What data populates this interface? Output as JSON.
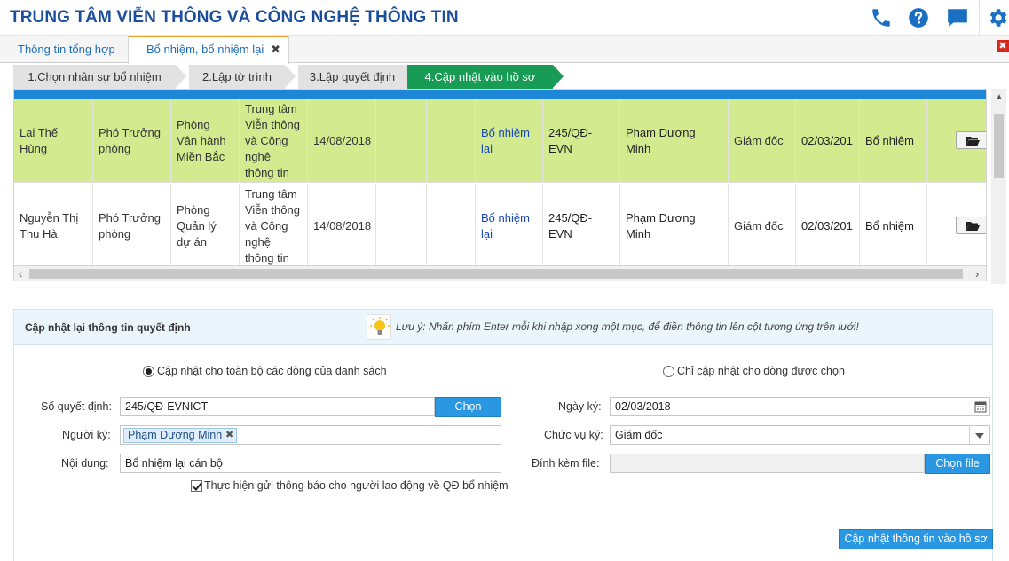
{
  "app": {
    "title": "TRUNG TÂM VIỄN THÔNG VÀ CÔNG NGHỆ THÔNG TIN"
  },
  "header_icons": [
    "phone-icon",
    "help-icon",
    "chat-icon",
    "gear-icon"
  ],
  "colors": {
    "brand": "#1b4e9b",
    "accent_blue": "#1e86d6",
    "step_active": "#189b54",
    "row_highlight": "#d3ea8f",
    "button_blue": "#2a97e3"
  },
  "tabs": [
    {
      "label": "Thông tin tổng hợp",
      "active": false
    },
    {
      "label": "Bổ nhiệm, bổ nhiệm lại",
      "active": true,
      "close": "✖"
    }
  ],
  "window_close": "✖",
  "steps": [
    {
      "label": "1.Chọn nhân sự bổ nhiệm"
    },
    {
      "label": "2.Lập tờ trình"
    },
    {
      "label": "3.Lập quyết định"
    },
    {
      "label": "4.Cập nhật vào hồ sơ",
      "active": true
    }
  ],
  "grid": {
    "rows": [
      {
        "name": "Lại Thế Hùng",
        "position": "Phó Trưởng phòng",
        "department": "Phòng Vận hành Miền Bắc",
        "unit": "Trung tâm Viễn thông và Công nghệ thông tin",
        "date": "14/08/2018",
        "col6": "",
        "col7": "",
        "type": "Bổ nhiệm lại",
        "decision_no": "245/QĐ-EVN",
        "signer": "Phạm Dương Minh",
        "signer_title": "Giám đốc",
        "sign_date": "02/03/201",
        "content": "Bổ nhiệm",
        "selected": true
      },
      {
        "name": "Nguyễn Thị Thu Hà",
        "position": "Phó Trưởng phòng",
        "department": "Phòng Quản lý dự án",
        "unit": "Trung tâm Viễn thông và Công nghệ thông tin",
        "date": "14/08/2018",
        "col6": "",
        "col7": "",
        "type": "Bổ nhiệm lại",
        "decision_no": "245/QĐ-EVN",
        "signer": "Phạm Dương Minh",
        "signer_title": "Giám đốc",
        "sign_date": "02/03/201",
        "content": "Bổ nhiệm",
        "selected": false
      }
    ],
    "scroll_left": "‹",
    "scroll_right": "›",
    "scroll_up": "▲",
    "scroll_down": "▼"
  },
  "panel": {
    "title": "Cập nhật lại thông tin quyết định",
    "note": "Lưu ý: Nhấn phím Enter mỗi khi nhập xong một mục, để điền thông tin lên cột tương ứng trên lưới!",
    "radio_all": "Cập nhật cho toàn bộ các dòng của danh sách",
    "radio_selected": "Chỉ cập nhật cho dòng được chọn",
    "decision_label": "Số quyết định:",
    "decision_value": "245/QĐ-EVNICT",
    "choose_label": "Chọn",
    "signer_label": "Người ký:",
    "signer_tag": "Phạm Dương Minh",
    "signer_tag_remove": "✖",
    "content_label": "Nội dung:",
    "content_value": "Bổ nhiệm lại cán bộ",
    "notify_label": "Thực hiện gửi thông báo cho người lao động về QĐ bổ nhiệm",
    "date_label": "Ngày ký:",
    "date_value": "02/03/2018",
    "title_label": "Chức vụ ký:",
    "title_value": "Giám đốc",
    "attach_label": "Đính kèm file:",
    "attach_button": "Chọn file",
    "submit_button": "Cập nhật thông tin vào hồ sơ"
  }
}
